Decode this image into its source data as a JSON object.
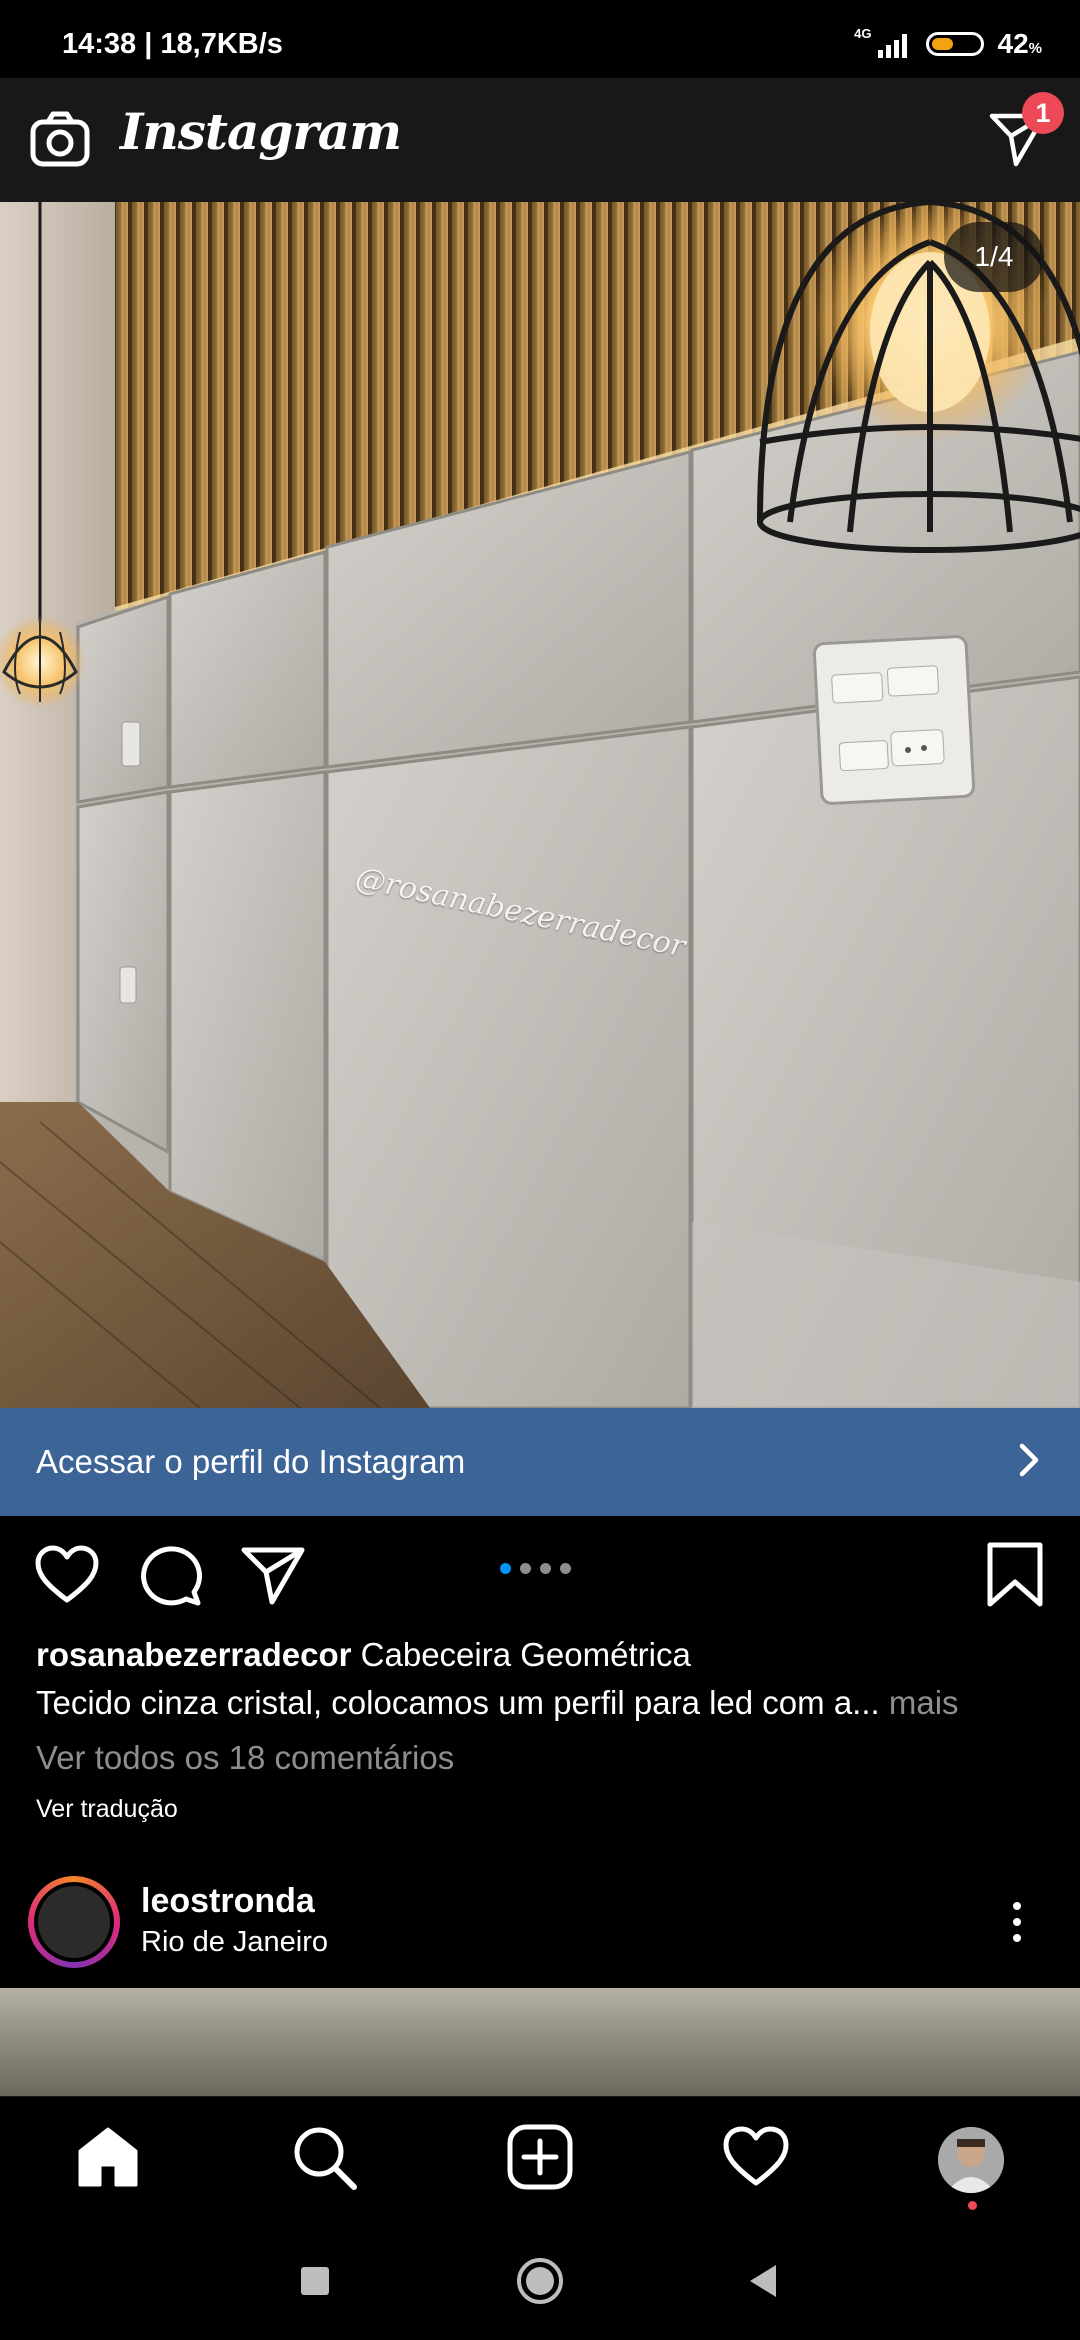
{
  "status_bar": {
    "time_speed": "14:38 | 18,7KB/s",
    "network": "4G",
    "battery_percent": "42",
    "battery_percent_sign": "%",
    "battery_level": 0.42
  },
  "header": {
    "app_name": "Instagram",
    "direct_badge_count": "1"
  },
  "post": {
    "photo_counter": "1/4",
    "watermark": "@rosanabezerradecor",
    "profile_banner_label": "Acessar o perfil do Instagram",
    "carousel_total": 4,
    "carousel_active_index": 0,
    "username": "rosanabezerradecor",
    "caption_title": "Cabeceira Geométrica",
    "caption_text": "Tecido cinza cristal, colocamos um perfil para led com a...",
    "more_label": "mais",
    "comments_link": "Ver todos os 18 comentários",
    "translate_link": "Ver tradução"
  },
  "next_post": {
    "username": "leostronda",
    "location": "Rio de Janeiro"
  },
  "colors": {
    "banner_blue": "#3d6496",
    "badge_red": "#ed4956",
    "dot_active": "#0095f6",
    "battery_fill": "#f2a30f"
  },
  "icons": {
    "header_left": "camera-icon",
    "header_right": "direct-message-icon",
    "actions": [
      "heart-icon",
      "comment-icon",
      "share-icon",
      "bookmark-icon"
    ],
    "nav": [
      "home-icon",
      "search-icon",
      "add-post-icon",
      "activity-heart-icon",
      "profile-avatar"
    ],
    "system": [
      "recents-square-icon",
      "home-circle-icon",
      "back-triangle-icon"
    ]
  }
}
